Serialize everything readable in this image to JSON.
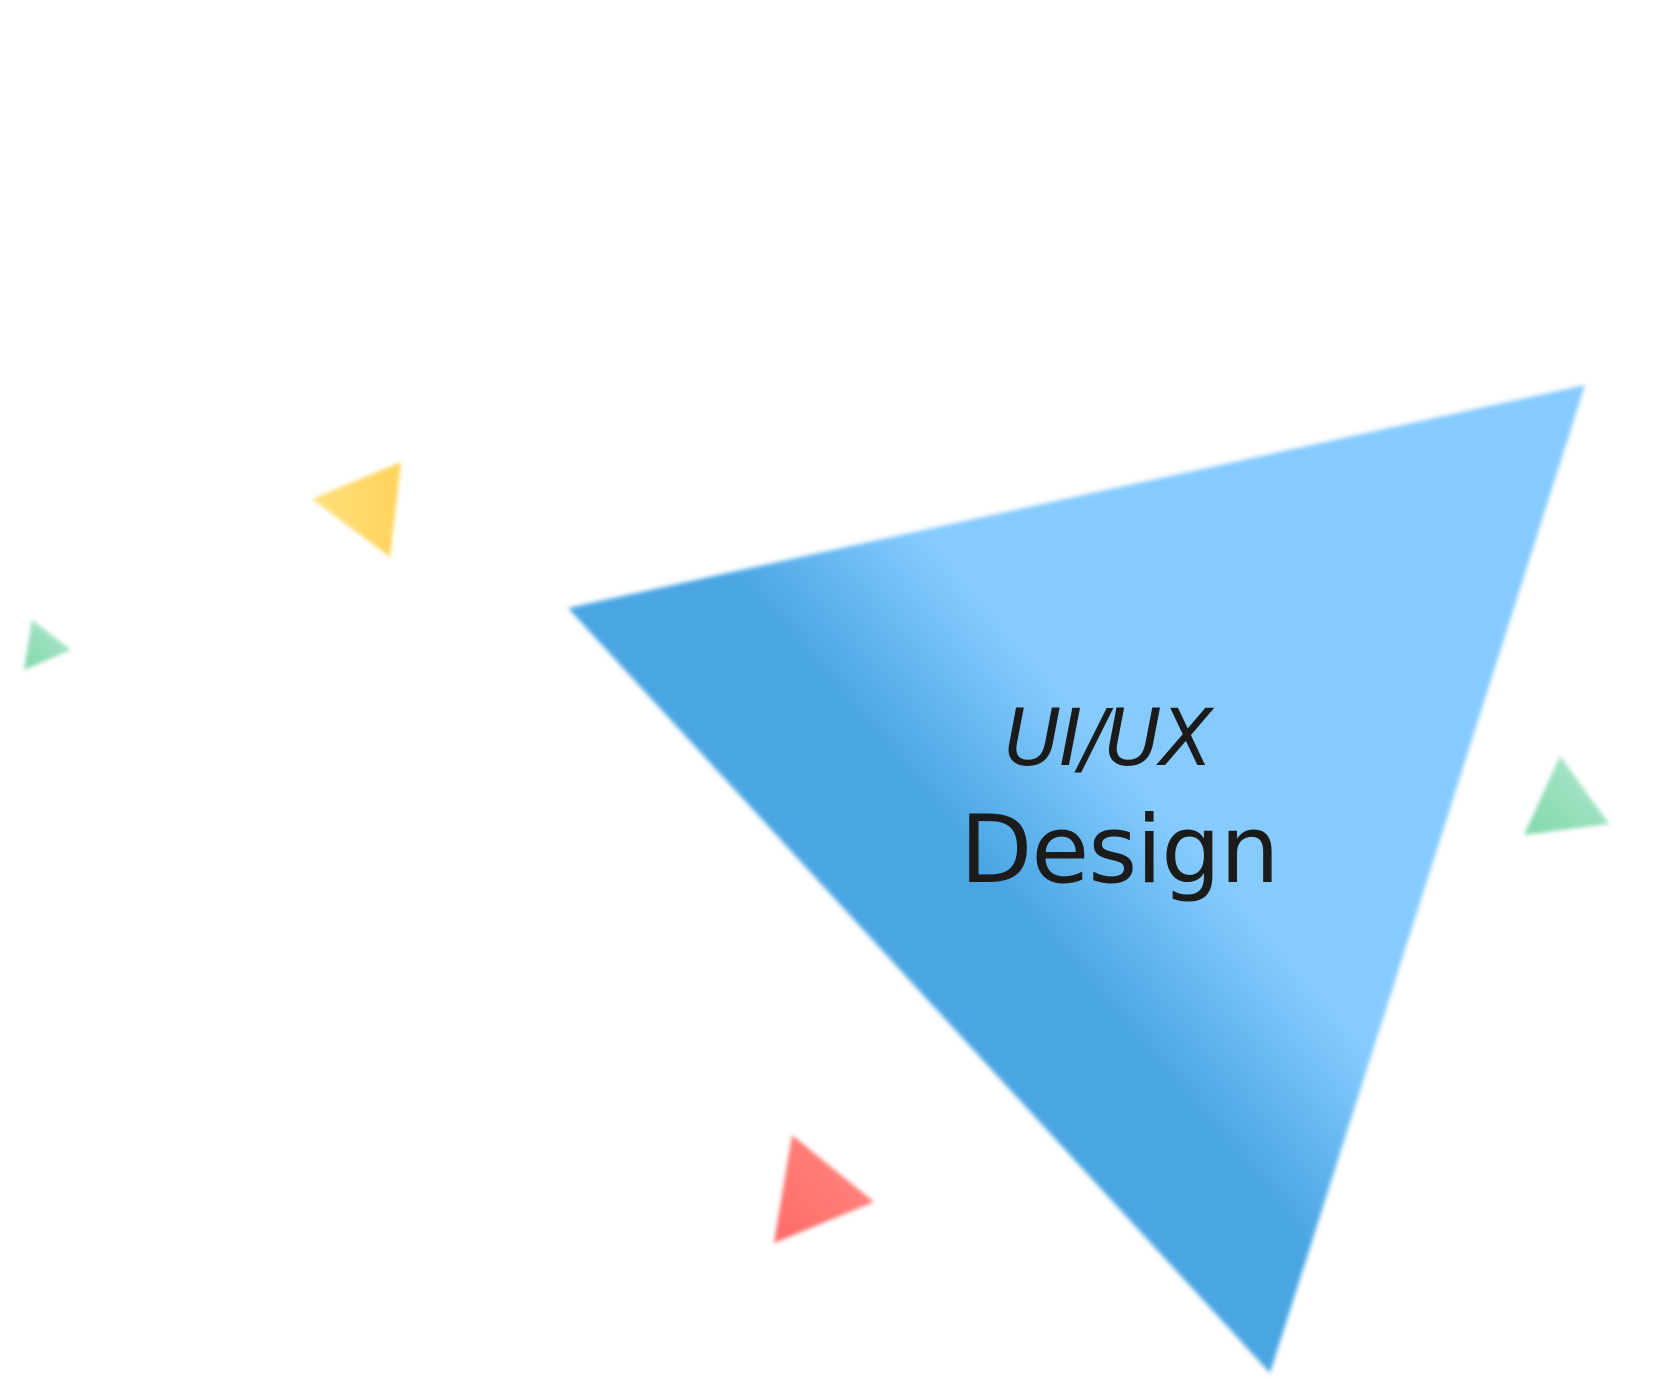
{
  "hero": {
    "title_line1": "UI/UX",
    "title_line2": "Design"
  },
  "colors": {
    "main_triangle_dark": "#4aa6e3",
    "main_triangle_light": "#86cbff",
    "yellow": "#ffd868",
    "red": "#ff7672",
    "green": "#8fdcb5"
  }
}
